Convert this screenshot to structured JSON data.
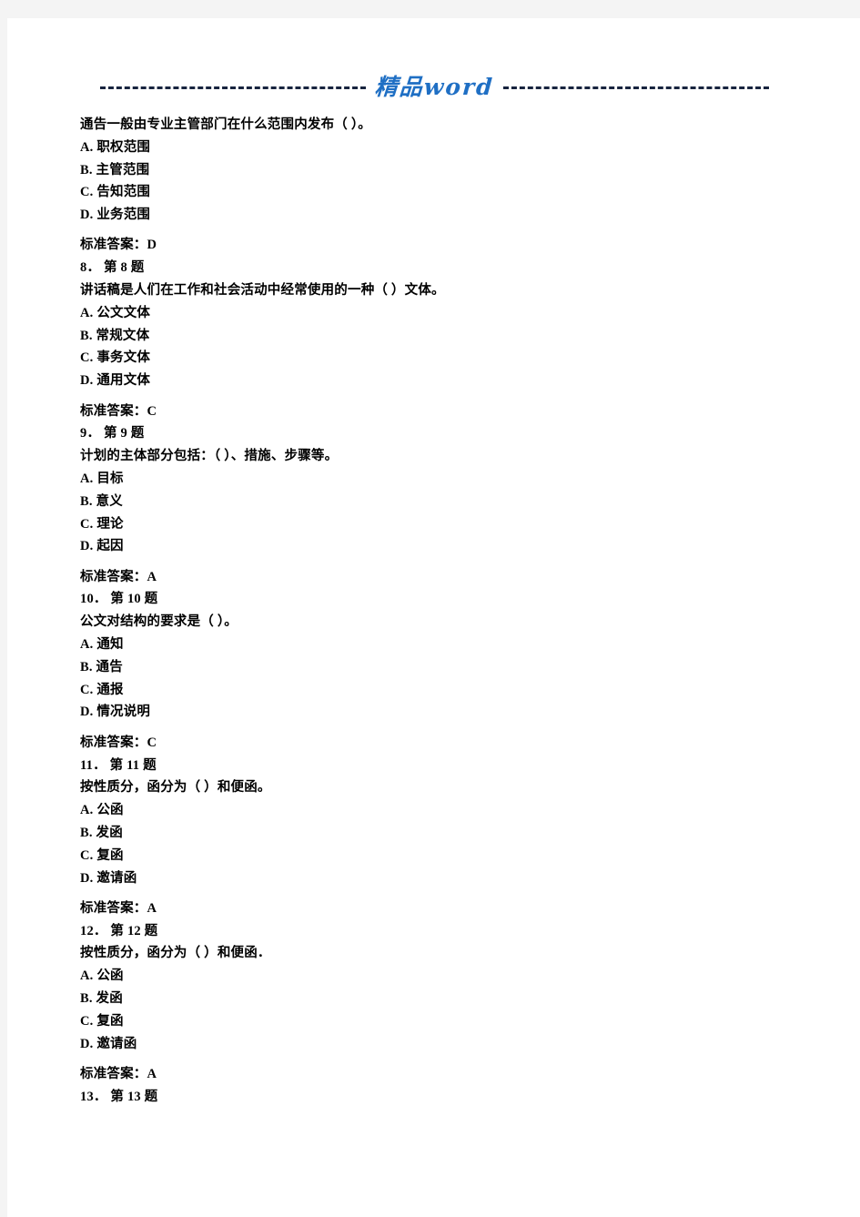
{
  "header": {
    "watermark_text": "精品word",
    "watermark_color": "#1f6fc4",
    "dash_color": "#18243f"
  },
  "document": {
    "answer_prefix": "标准答案：",
    "blocks": [
      {
        "number_line": null,
        "stem": "通告一般由专业主管部门在什么范围内发布（ ）。",
        "options": [
          "A. 职权范围",
          "B. 主管范围",
          "C. 告知范围",
          "D. 业务范围"
        ],
        "answer_line": "标准答案：D"
      },
      {
        "number_line": "8． 第 8 题",
        "stem": "讲话稿是人们在工作和社会活动中经常使用的一种（ ）文体。",
        "options": [
          "A. 公文文体",
          "B. 常规文体",
          "C. 事务文体",
          "D. 通用文体"
        ],
        "answer_line": "标准答案：C"
      },
      {
        "number_line": "9． 第 9 题",
        "stem": "计划的主体部分包括：（ ）、措施、步骤等。",
        "options": [
          "A. 目标",
          "B. 意义",
          "C. 理论",
          "D. 起因"
        ],
        "answer_line": "标准答案：A"
      },
      {
        "number_line": "10． 第 10 题",
        "stem": "公文对结构的要求是（ ）。",
        "options": [
          "A. 通知",
          "B. 通告",
          "C. 通报",
          "D. 情况说明"
        ],
        "answer_line": "标准答案：C"
      },
      {
        "number_line": "11． 第 11 题",
        "stem": "按性质分，函分为（ ）和便函。",
        "options": [
          "A. 公函",
          "B. 发函",
          "C. 复函",
          "D. 邀请函"
        ],
        "answer_line": "标准答案：A"
      },
      {
        "number_line": "12． 第 12 题",
        "stem": "按性质分，函分为（ ）和便函．",
        "options": [
          "A. 公函",
          "B. 发函",
          "C. 复函",
          "D. 邀请函"
        ],
        "answer_line": "标准答案：A"
      },
      {
        "number_line": "13． 第 13 题",
        "stem": null,
        "options": [],
        "answer_line": null
      }
    ]
  }
}
